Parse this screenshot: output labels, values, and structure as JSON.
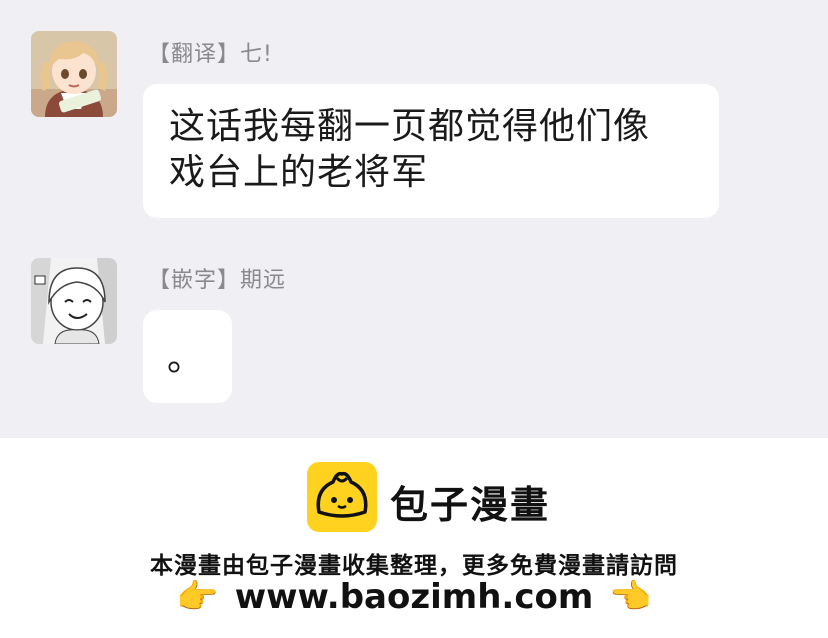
{
  "messages": [
    {
      "sender": "【翻译】七!",
      "lines": [
        "这话我每翻一页都觉得他们像",
        "戏台上的老将军"
      ]
    },
    {
      "sender": "【嵌字】期远",
      "lines": [
        "。"
      ]
    }
  ],
  "footer": {
    "brand": "包子漫畫",
    "notice": "本漫畫由包子漫畫收集整理，更多免費漫畫請訪問",
    "url": "www.baozimh.com",
    "hand_left": "👉",
    "hand_right": "👈"
  },
  "colors": {
    "chat_background": "#efeff4",
    "bubble": "#ffffff",
    "sender_text": "#8a8a8e",
    "logo": "#ffd21f"
  }
}
